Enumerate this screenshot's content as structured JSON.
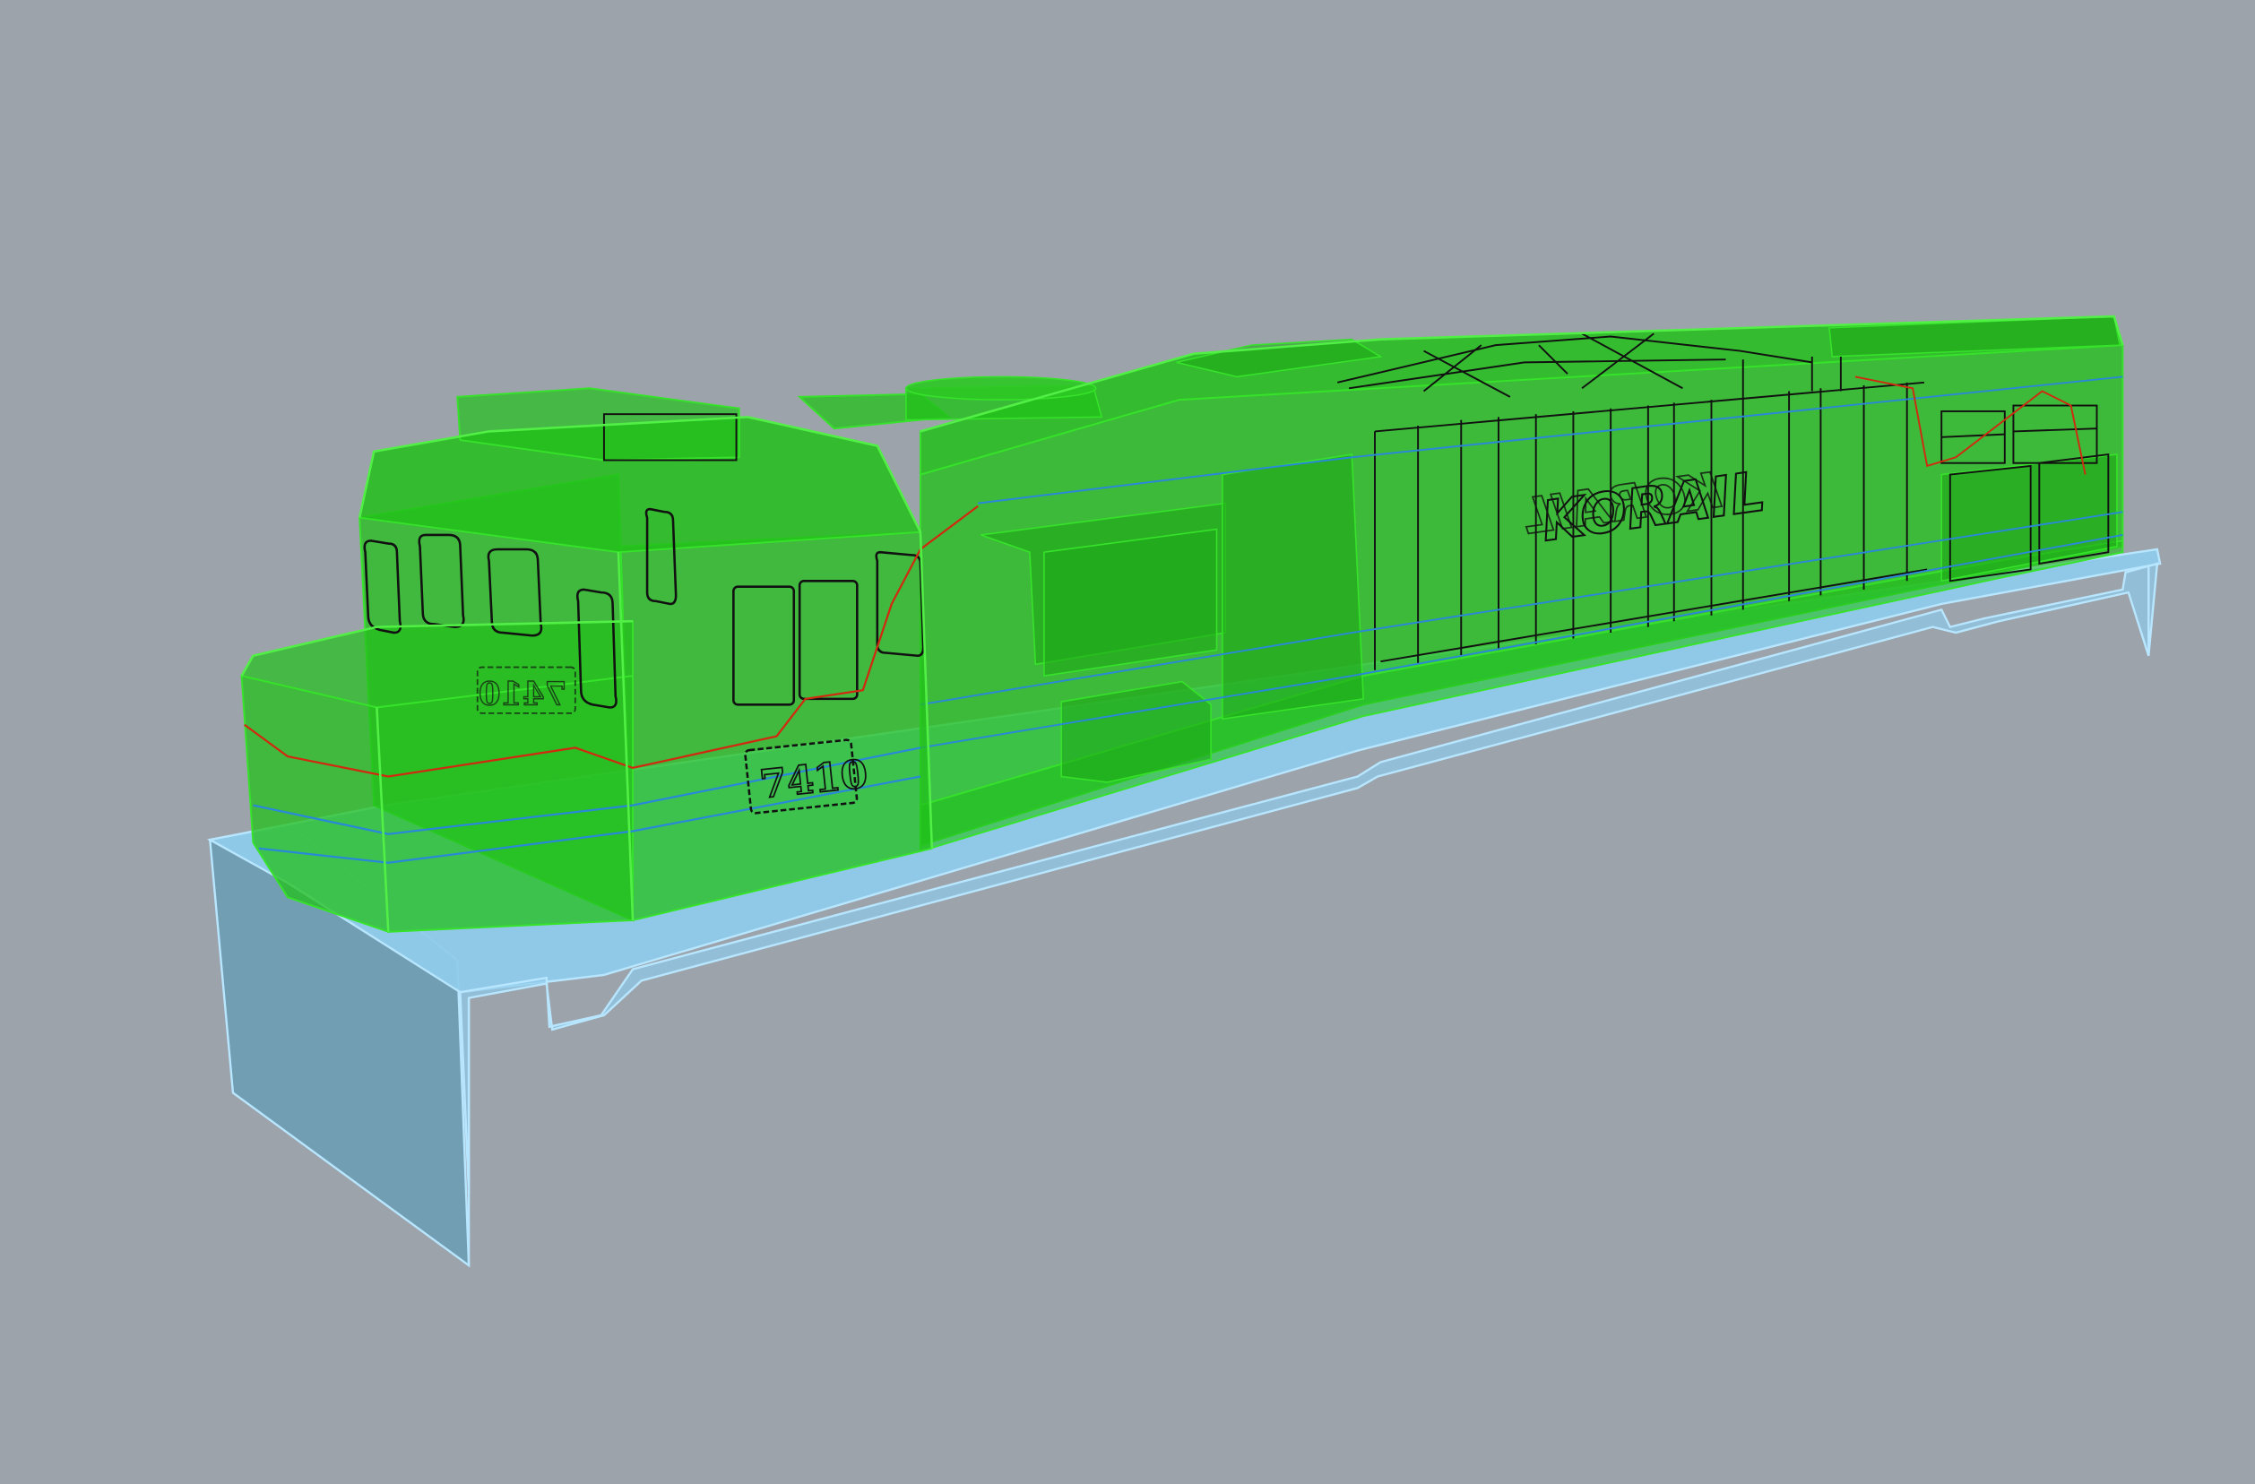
{
  "scene": {
    "background": "#9ca3aa",
    "shell_color": "#22c01a",
    "shell_edge_color": "#36e22a",
    "chassis_color": "#8fcbea",
    "chassis_edge_color": "#b8e6ff",
    "line_black": "#111111",
    "line_red": "#d02a10",
    "line_blue": "#2a88d8"
  },
  "locomotive": {
    "cab_number": "7410",
    "cab_number_mirrored": "7410",
    "logo_text": "KORAIL",
    "logo_text_mirrored": "KORAIL"
  }
}
